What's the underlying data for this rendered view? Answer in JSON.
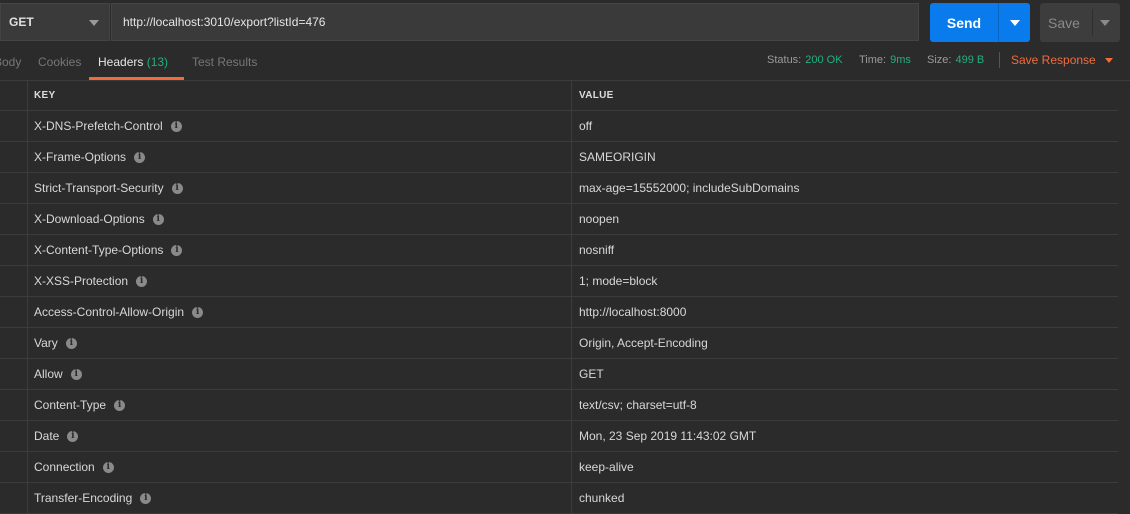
{
  "request": {
    "method": "GET",
    "url": "http://localhost:3010/export?listId=476",
    "send_label": "Send",
    "save_label": "Save"
  },
  "tabs": [
    {
      "label": "Body"
    },
    {
      "label": "Cookies"
    },
    {
      "label": "Headers",
      "count": "(13)"
    },
    {
      "label": "Test Results"
    }
  ],
  "status": {
    "status_label": "Status:",
    "status_value": "200 OK",
    "time_label": "Time:",
    "time_value": "9ms",
    "size_label": "Size:",
    "size_value": "499 B",
    "save_response_label": "Save Response"
  },
  "table": {
    "key_header": "KEY",
    "value_header": "VALUE",
    "rows": [
      {
        "key": "X-DNS-Prefetch-Control",
        "value": "off"
      },
      {
        "key": "X-Frame-Options",
        "value": "SAMEORIGIN"
      },
      {
        "key": "Strict-Transport-Security",
        "value": "max-age=15552000; includeSubDomains"
      },
      {
        "key": "X-Download-Options",
        "value": "noopen"
      },
      {
        "key": "X-Content-Type-Options",
        "value": "nosniff"
      },
      {
        "key": "X-XSS-Protection",
        "value": "1; mode=block"
      },
      {
        "key": "Access-Control-Allow-Origin",
        "value": "http://localhost:8000"
      },
      {
        "key": "Vary",
        "value": "Origin, Accept-Encoding"
      },
      {
        "key": "Allow",
        "value": "GET"
      },
      {
        "key": "Content-Type",
        "value": "text/csv; charset=utf-8"
      },
      {
        "key": "Date",
        "value": "Mon, 23 Sep 2019 11:43:02 GMT"
      },
      {
        "key": "Connection",
        "value": "keep-alive"
      },
      {
        "key": "Transfer-Encoding",
        "value": "chunked"
      }
    ]
  },
  "colors": {
    "accent": "#f26b3a",
    "send_button": "#097bed",
    "status_ok": "#20b07f",
    "background": "#2b2b2b"
  },
  "icons": {
    "info": "info-icon",
    "method_dropdown": "chevron-down-icon"
  }
}
